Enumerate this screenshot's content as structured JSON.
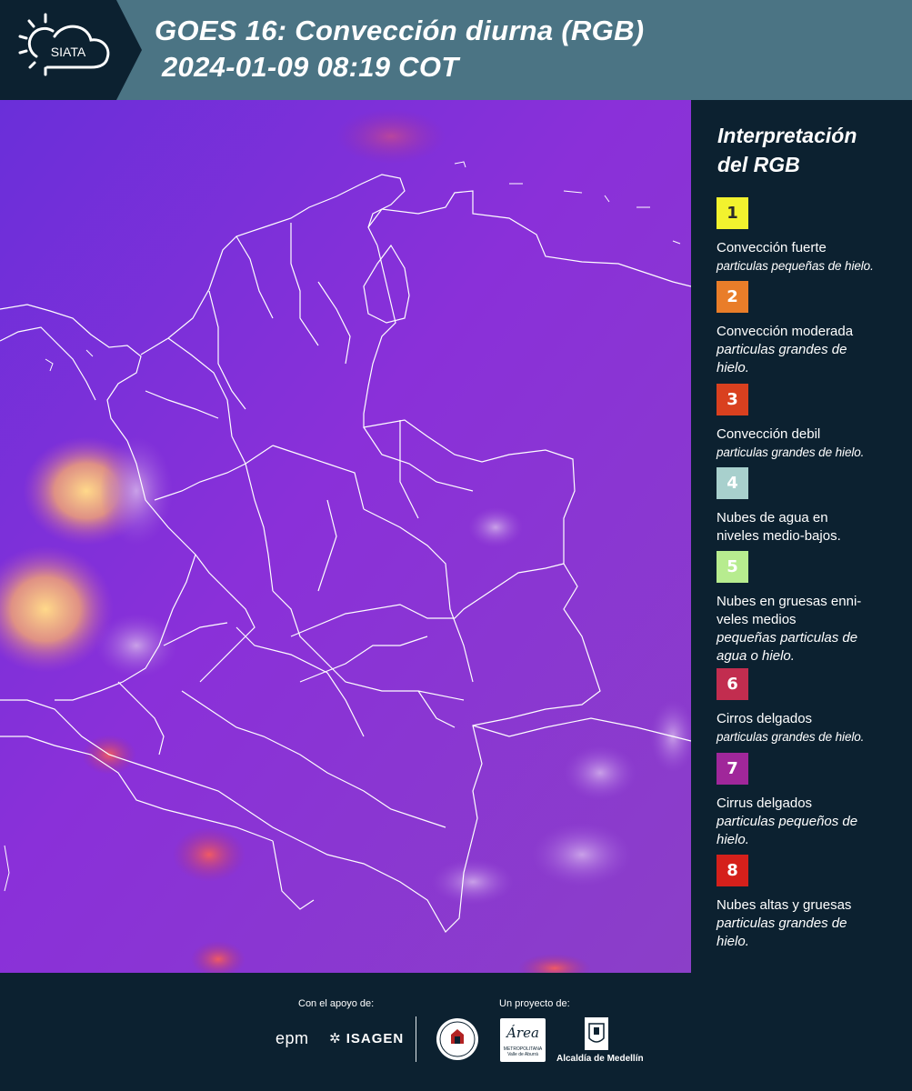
{
  "header": {
    "logo_text": "SIATA",
    "title_line1": "GOES 16: Convección diurna (RGB)",
    "title_line2": "2024-01-09 08:19 COT"
  },
  "map": {
    "background_color": "#8a2fd6",
    "border_color": "#ffffff",
    "icon": "satellite-map"
  },
  "legend": {
    "title_line1": "Interpretación",
    "title_line2": "del RGB",
    "items": [
      {
        "number": "1",
        "color": "#f2f22e",
        "text_color": "#2a2a2a",
        "name": "Convección fuerte",
        "desc": "particulas pequeñas de hielo."
      },
      {
        "number": "2",
        "color": "#e97d29",
        "text_color": "#ffffff",
        "name": "Convección moderada",
        "desc": "particulas grandes de hielo."
      },
      {
        "number": "3",
        "color": "#d9401f",
        "text_color": "#ffffff",
        "name": "Convección debil",
        "desc": "particulas grandes de hielo."
      },
      {
        "number": "4",
        "color": "#a8d0cd",
        "text_color": "#ffffff",
        "name": "Nubes de agua en niveles medio-bajos.",
        "desc": ""
      },
      {
        "number": "5",
        "color": "#b7ec8f",
        "text_color": "#ffffff",
        "name": "Nubes en gruesas enni-veles medios",
        "desc": "pequeñas particulas de agua o hielo."
      },
      {
        "number": "6",
        "color": "#c22d4f",
        "text_color": "#ffffff",
        "name": "Cirros delgados",
        "desc": "particulas grandes de hielo."
      },
      {
        "number": "7",
        "color": "#a0279a",
        "text_color": "#ffffff",
        "name": "Cirrus delgados",
        "desc": "particulas pequeños de hielo."
      },
      {
        "number": "8",
        "color": "#d5201b",
        "text_color": "#ffffff",
        "name": "Nubes altas y gruesas",
        "desc": "particulas grandes de hielo."
      }
    ]
  },
  "footer": {
    "support_label": "Con el apoyo de:",
    "project_label": "Un proyecto de:",
    "sponsor1": "epm",
    "sponsor2": "ISAGEN",
    "partner_area_logo": "Área",
    "partner_area_sub": "METROPOLITANA Valle de Aburrá",
    "partner_alcaldia": "Alcaldía de Medellín"
  }
}
